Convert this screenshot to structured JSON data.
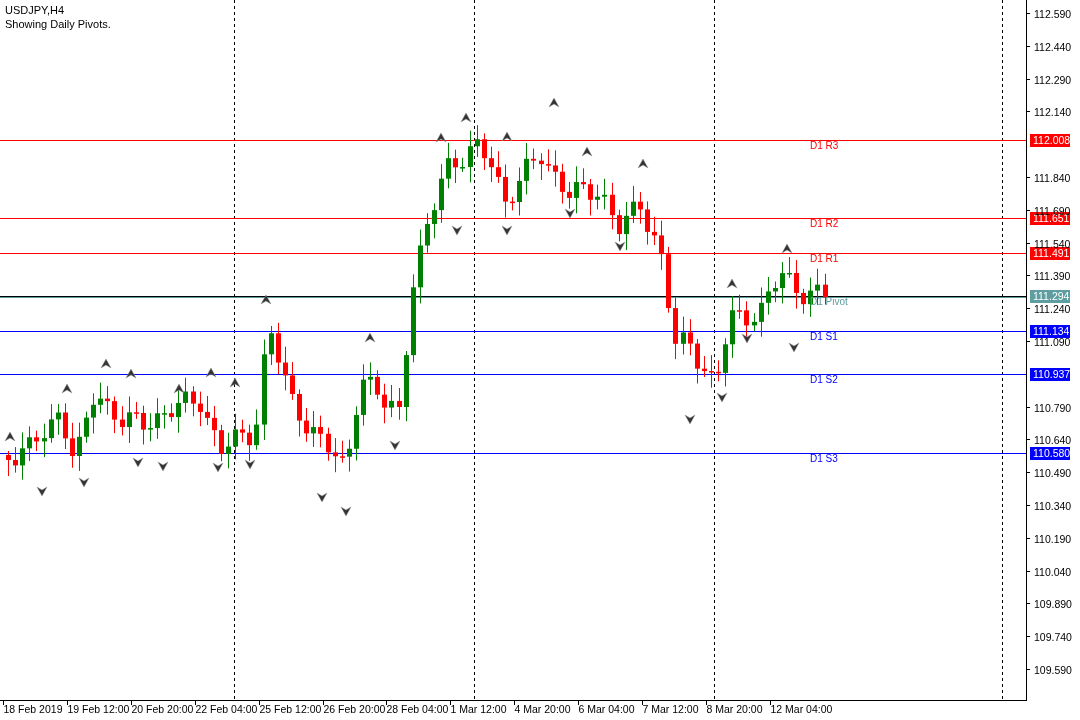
{
  "symbol_title": "USDJPY,H4",
  "indicator_note": "Showing Daily Pivots.",
  "price_axis": {
    "ticks": [
      "112.590",
      "112.440",
      "112.290",
      "112.140",
      "111.840",
      "111.690",
      "111.540",
      "111.390",
      "111.240",
      "111.090",
      "110.790",
      "110.640",
      "110.490",
      "110.340",
      "110.190",
      "110.040",
      "109.890",
      "109.740",
      "109.590"
    ]
  },
  "time_axis": {
    "ticks": [
      "18 Feb 2019",
      "19 Feb 12:00",
      "20 Feb 20:00",
      "22 Feb 04:00",
      "25 Feb 12:00",
      "26 Feb 20:00",
      "28 Feb 04:00",
      "1 Mar 12:00",
      "4 Mar 20:00",
      "6 Mar 04:00",
      "7 Mar 12:00",
      "8 Mar 20:00",
      "12 Mar 04:00"
    ]
  },
  "pivot_levels": [
    {
      "kind": "level",
      "label": "D1 R3",
      "price": "112.008",
      "color": "#ff0000"
    },
    {
      "kind": "level",
      "label": "D1 R2",
      "price": "111.651",
      "color": "#ff0000"
    },
    {
      "kind": "level",
      "label": "D1 R1",
      "price": "111.491",
      "color": "#ff0000"
    },
    {
      "kind": "pivot",
      "label": "D1 Pivot",
      "price": "111.294",
      "color": "#5f9ea0"
    },
    {
      "kind": "level",
      "label": "D1 S1",
      "price": "111.134",
      "color": "#0000ff"
    },
    {
      "kind": "level",
      "label": "D1 S2",
      "price": "110.937",
      "color": "#0000ff"
    },
    {
      "kind": "level",
      "label": "D1 S3",
      "price": "110.580",
      "color": "#0000ff"
    }
  ]
}
